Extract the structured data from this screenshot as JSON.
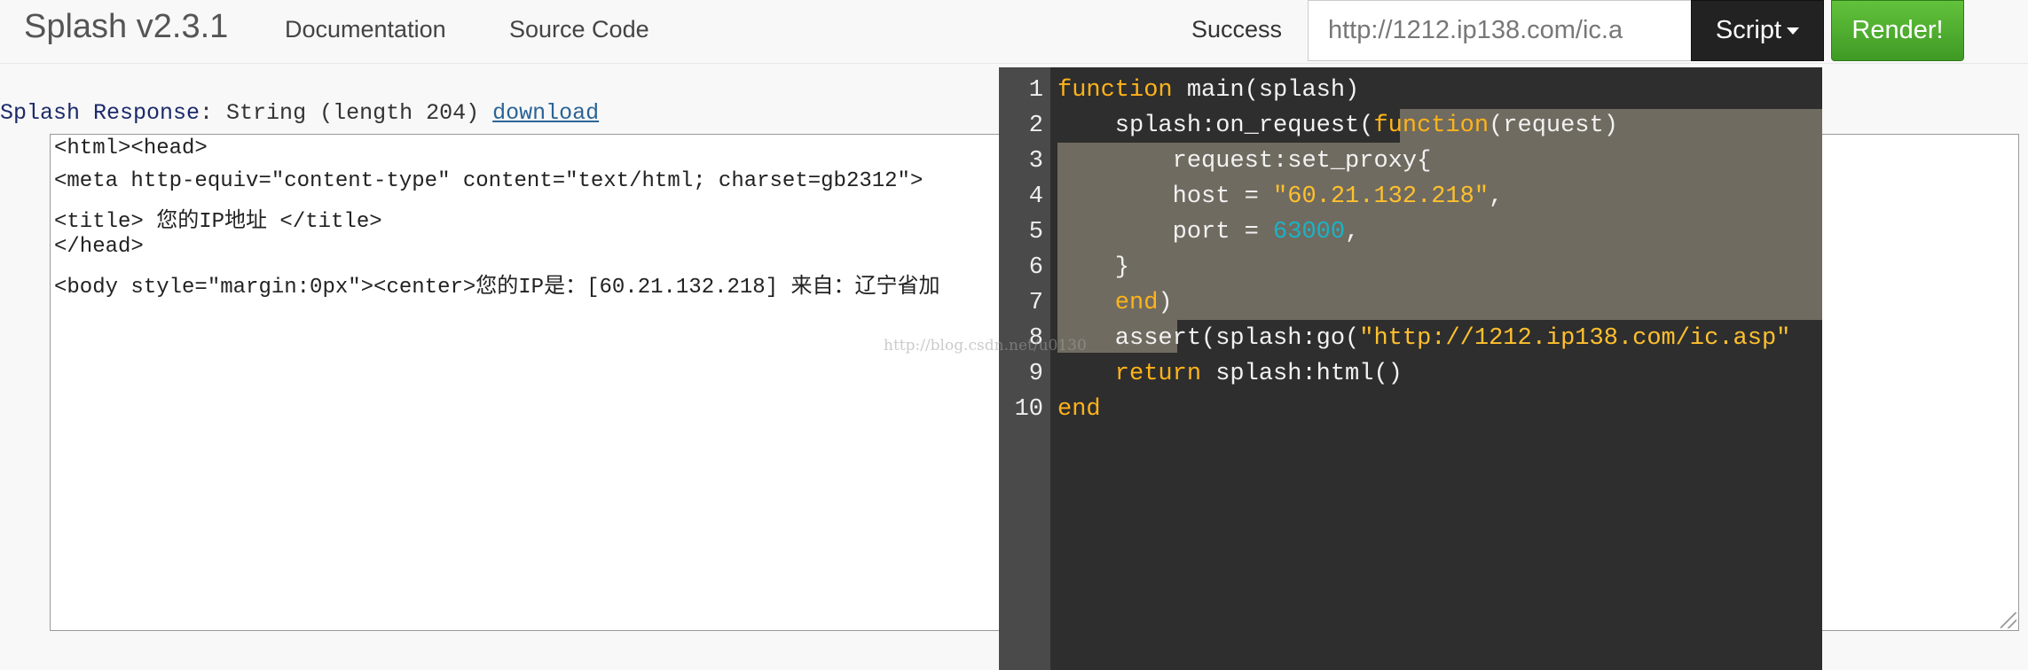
{
  "navbar": {
    "brand": "Splash v2.3.1",
    "links": [
      "Documentation",
      "Source Code"
    ],
    "status": "Success",
    "url_value": "http://1212.ip138.com/ic.a",
    "script_label": "Script",
    "render_label": "Render!"
  },
  "response": {
    "label": "Splash Response",
    "info": ": String (length 204)",
    "download_label": "download",
    "lines": [
      "<html><head>",
      "<meta http-equiv=\"content-type\" content=\"text/html; charset=gb2312\">",
      "<title> 您的IP地址 </title>",
      "</head>",
      "<body style=\"margin:0px\"><center>您的IP是：[60.21.132.218] 来自：辽宁省加"
    ]
  },
  "editor": {
    "line_numbers": [
      "1",
      "2",
      "3",
      "4",
      "5",
      "6",
      "7",
      "8",
      "9",
      "10"
    ],
    "code": {
      "l1_kw": "function",
      "l1_rest": " main(splash)",
      "l2_a": "    splash:on_request(",
      "l2_kw": "function",
      "l2_b": "(request)",
      "l3": "        request:set_proxy{",
      "l4_a": "        host = ",
      "l4_str": "\"60.21.132.218\"",
      "l4_b": ",",
      "l5_a": "        port = ",
      "l5_num": "63000",
      "l5_b": ",",
      "l6": "    }",
      "l7_kw": "    end",
      "l7_b": ")",
      "l8_a": "    assert(splash:go(",
      "l8_str": "\"http://1212.ip138.com/ic.asp\"",
      "l9_kw": "    return",
      "l9_b": " splash:html()",
      "l10_kw": "end"
    }
  },
  "watermark": "http://blog.csdn.net/u0130"
}
